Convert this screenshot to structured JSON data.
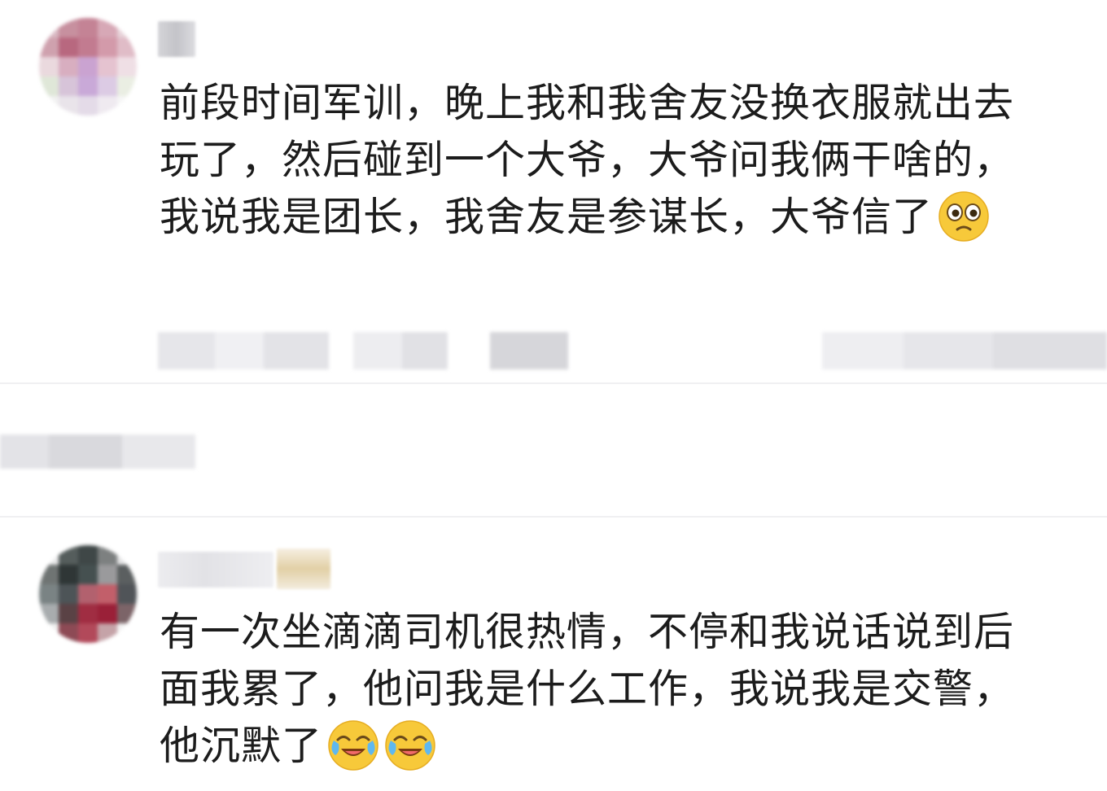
{
  "comments": [
    {
      "username": "",
      "text": "前段时间军训，晚上我和我舍友没换衣服就出去玩了，然后碰到一个大爷，大爷问我俩干啥的，我说我是团长，我舍友是参谋长，大爷信了",
      "emoji_names": [
        "flushed-face-emoji"
      ]
    },
    {
      "username": "",
      "text": "有一次坐滴滴司机很热情，不停和我说话说到后面我累了，他问我是什么工作，我说我是交警，他沉默了",
      "emoji_names": [
        "tears-of-joy-emoji",
        "tears-of-joy-emoji"
      ]
    }
  ],
  "colors": {
    "text": "#1c1c1c",
    "emoji_yellow": "#f7c93a",
    "divider": "#f0f0f2"
  }
}
